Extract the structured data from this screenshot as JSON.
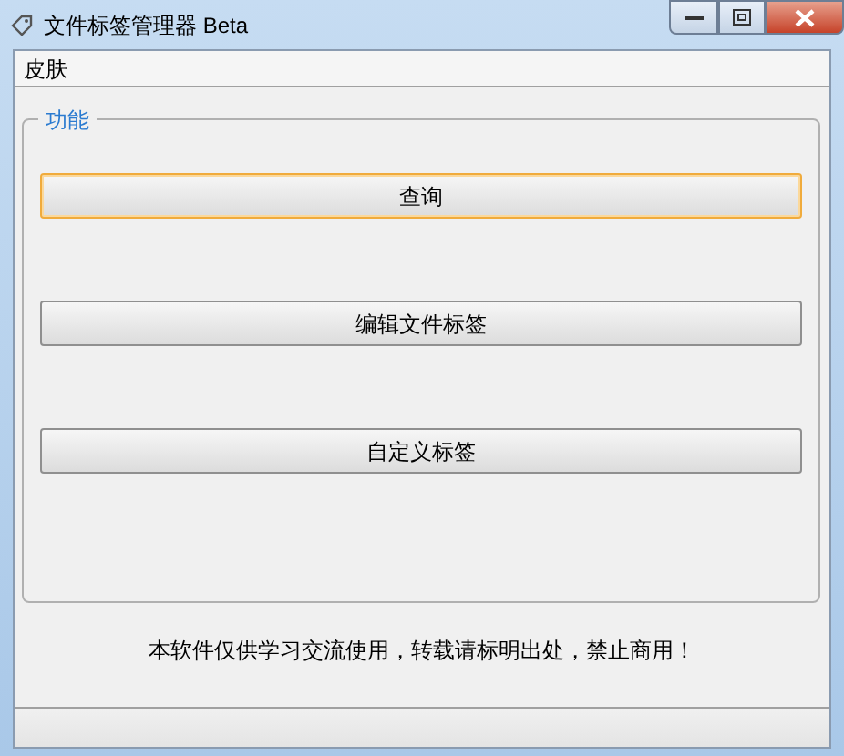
{
  "window": {
    "title": "文件标签管理器 Beta"
  },
  "menu": [
    {
      "label": "皮肤"
    }
  ],
  "group": {
    "title": "功能",
    "buttons": [
      {
        "label": "查询",
        "focused": true
      },
      {
        "label": "编辑文件标签",
        "focused": false
      },
      {
        "label": "自定义标签",
        "focused": false
      }
    ]
  },
  "footer": "本软件仅供学习交流使用，转载请标明出处，禁止商用！"
}
